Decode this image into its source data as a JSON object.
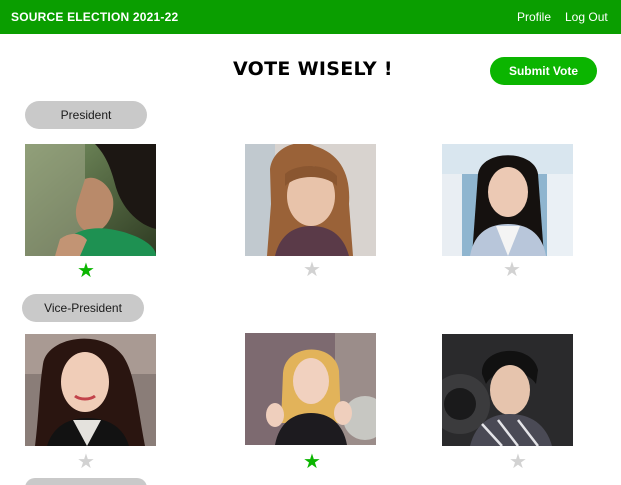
{
  "header": {
    "brand": "SOURCE ELECTION 2021-22",
    "nav": {
      "profile": "Profile",
      "logout": "Log Out"
    },
    "color": "#0a9e00"
  },
  "main": {
    "title": "VOTE WISELY !",
    "submit_label": "Submit Vote",
    "accent_color": "#0bb500"
  },
  "positions": [
    {
      "label": "President",
      "candidates": [
        {
          "photo": "candidate-photo",
          "selected": true
        },
        {
          "photo": "candidate-photo",
          "selected": false
        },
        {
          "photo": "candidate-photo",
          "selected": false
        }
      ]
    },
    {
      "label": "Vice-President",
      "candidates": [
        {
          "photo": "candidate-photo",
          "selected": false
        },
        {
          "photo": "candidate-photo",
          "selected": true
        },
        {
          "photo": "candidate-photo",
          "selected": false
        }
      ]
    },
    {
      "label": "",
      "candidates": []
    }
  ],
  "icons": {
    "selected_star": "star-filled-icon",
    "unselected_star": "star-outline-icon"
  }
}
